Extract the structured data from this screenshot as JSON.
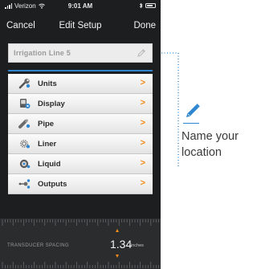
{
  "status_bar": {
    "carrier": "Verizon",
    "time": "9:01 AM"
  },
  "nav": {
    "cancel_label": "Cancel",
    "title": "Edit Setup",
    "done_label": "Done"
  },
  "name_field": {
    "value": "Irrigation Line 5",
    "icon": "pencil-icon"
  },
  "menu": {
    "items": [
      {
        "label": "Units",
        "icon": "wrench-icon"
      },
      {
        "label": "Display",
        "icon": "display-gear-icon"
      },
      {
        "label": "Pipe",
        "icon": "pipe-icon"
      },
      {
        "label": "Liner",
        "icon": "liner-icon"
      },
      {
        "label": "Liquid",
        "icon": "liquid-icon"
      },
      {
        "label": "Outputs",
        "icon": "outputs-icon"
      }
    ],
    "chevron": ">"
  },
  "transducer": {
    "label": "TRANSDUCER SPACING",
    "value": "1.34",
    "unit": "inches"
  },
  "callout": {
    "line1": "Name your",
    "line2": "location",
    "icon": "edit-pencil-icon"
  },
  "colors": {
    "accent": "#2e85d0",
    "chevron": "#f28c1a",
    "background": "#1d1e20"
  }
}
